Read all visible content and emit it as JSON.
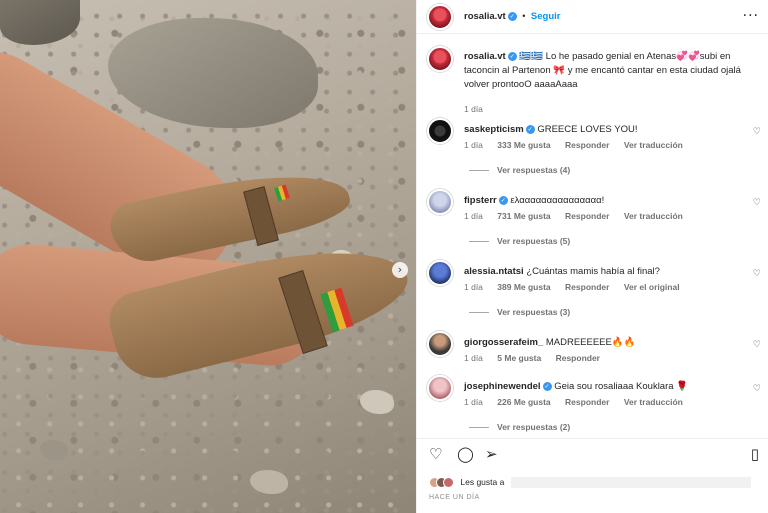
{
  "post": {
    "author": "rosalia.vt",
    "follow_label": "Seguir",
    "more_icon": "more-horizontal-icon",
    "caption": "🇬🇷🇬🇷 Lo he pasado genial en Atenas💞💞subi en taconcin al Partenon 🎀 y me encantó cantar en esta ciudad ojalá volver prontooO aaaaAaaa",
    "caption_time": "1 día"
  },
  "comments": [
    {
      "user": "saskepticism",
      "text": "GREECE LOVES YOU!",
      "time": "1 día",
      "likes": "333 Me gusta",
      "reply": "Responder",
      "translate": "Ver traducción",
      "view_replies": "Ver respuestas (4)"
    },
    {
      "user": "fipsterr",
      "text": "ελααααααααααααααα!",
      "time": "1 día",
      "likes": "731 Me gusta",
      "reply": "Responder",
      "translate": "Ver traducción",
      "view_replies": "Ver respuestas (5)"
    },
    {
      "user": "alessia.ntatsi",
      "text": "¿Cuántas mamis había al final?",
      "time": "1 día",
      "likes": "389 Me gusta",
      "reply": "Responder",
      "translate": "Ver el original",
      "view_replies": "Ver respuestas (3)"
    },
    {
      "user": "giorgosserafeim_",
      "text": "MADREEEEEE🔥🔥",
      "time": "1 día",
      "likes": "5 Me gusta",
      "reply": "Responder"
    },
    {
      "user": "josephinewendel",
      "text": "Geia sou rosaliaaa Kouklara 🌹",
      "time": "1 día",
      "likes": "226 Me gusta",
      "reply": "Responder",
      "translate": "Ver traducción",
      "view_replies": "Ver respuestas (2)"
    }
  ],
  "actions": {
    "likes_text": "Les gusta a",
    "posted_ago": "HACE UN DÍA"
  },
  "icons": [
    "heart-icon",
    "comment-icon",
    "share-icon",
    "bookmark-icon",
    "chevron-right-icon",
    "verified-badge-icon"
  ],
  "colors": {
    "link": "#0095f6",
    "verified": "#3897f0",
    "muted": "#737373"
  }
}
